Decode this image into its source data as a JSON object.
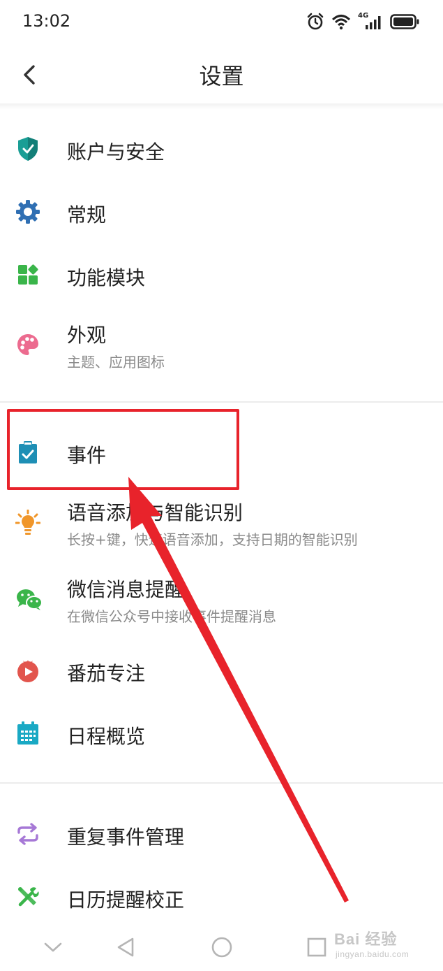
{
  "status_bar": {
    "time": "13:02",
    "network": "4G"
  },
  "header": {
    "title": "设置"
  },
  "settings": [
    {
      "label": "账户与安全",
      "subtitle": "",
      "icon": "shield-icon",
      "color": "#1a9e95"
    },
    {
      "label": "常规",
      "subtitle": "",
      "icon": "gear-icon",
      "color": "#2f6fb3"
    },
    {
      "label": "功能模块",
      "subtitle": "",
      "icon": "modules-icon",
      "color": "#3ab54a"
    },
    {
      "label": "外观",
      "subtitle": "主题、应用图标",
      "icon": "palette-icon",
      "color": "#ec6b8f"
    },
    {
      "label": "事件",
      "subtitle": "",
      "icon": "clipboard-check-icon",
      "color": "#1e8fb5"
    },
    {
      "label": "语音添加与智能识别",
      "subtitle": "长按+键，快速语音添加，支持日期的智能识别",
      "icon": "lightbulb-icon",
      "color": "#f0962a"
    },
    {
      "label": "微信消息提醒",
      "subtitle": "在微信公众号中接收事件提醒消息",
      "icon": "wechat-icon",
      "color": "#3ab54a"
    },
    {
      "label": "番茄专注",
      "subtitle": "",
      "icon": "tomato-icon",
      "color": "#e2554d"
    },
    {
      "label": "日程概览",
      "subtitle": "",
      "icon": "calendar-icon",
      "color": "#1aa9c4"
    },
    {
      "label": "重复事件管理",
      "subtitle": "",
      "icon": "repeat-icon",
      "color": "#a678d6"
    },
    {
      "label": "日历提醒校正",
      "subtitle": "",
      "icon": "tools-icon",
      "color": "#3ab54a"
    }
  ],
  "watermark": {
    "brand": "Bai 经验",
    "url": "jingyan.baidu.com"
  }
}
